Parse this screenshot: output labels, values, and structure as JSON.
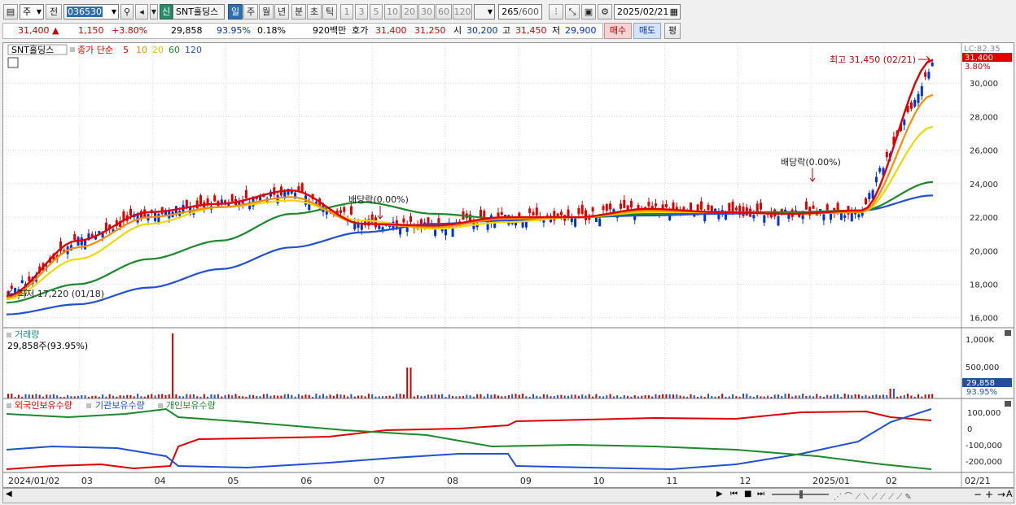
{
  "toolbar": {
    "period_select": "주",
    "prev_label": "전",
    "code": "036530",
    "badge": "신",
    "name": "SNT홀딩스",
    "tabs": [
      "일",
      "주",
      "월",
      "년",
      "분",
      "초",
      "틱"
    ],
    "active_tab": "일",
    "intervals": [
      "1",
      "3",
      "5",
      "10",
      "20",
      "30",
      "60",
      "120"
    ],
    "count": "265",
    "count_max": "/600",
    "date": "2025/02/21"
  },
  "quote": {
    "price": "31,400",
    "change_arrow": "▲",
    "change": "1,150",
    "change_pct": "+3.80%",
    "volume": "29,858",
    "volume_ratio": "93.95%",
    "turnover": "0.18%",
    "amount": "920백만",
    "ask_label": "호가",
    "ask": "31,400",
    "bid": "31,250",
    "open_label": "시",
    "open": "30,200",
    "high_label": "고",
    "high": "31,450",
    "low_label": "저",
    "low": "29,900",
    "buy_label": "매수",
    "sell_label": "매도",
    "eval_label": "평"
  },
  "legend": {
    "name": "SNT홀딩스",
    "close_label": "종가 단순",
    "ma_labels": [
      "5",
      "10",
      "20",
      "60",
      "120"
    ],
    "ma_colors": [
      "#e00000",
      "#ff8c00",
      "#f0d800",
      "#1a8a2a",
      "#2050d8"
    ]
  },
  "price_panel": {
    "lc_label": "LC:82.35",
    "current_price": "31,400",
    "current_pct": "3.80%",
    "y_ticks": [
      "30,000",
      "28,000",
      "26,000",
      "24,000",
      "22,000",
      "20,000",
      "18,000",
      "16,000"
    ],
    "high_annotation": "최고 31,450 (02/21)",
    "low_annotation": "최저 17,220 (01/18)",
    "dividend_label": "배당락(0.00%)"
  },
  "volume_panel": {
    "title": "거래량",
    "current": "29,858주(93.95%)",
    "y_ticks": [
      "1,000K",
      "500,000"
    ],
    "current_badge": "29,858",
    "current_pct": "93.95%"
  },
  "holdings_panel": {
    "legend": [
      "외국인보유수량",
      "기관보유수량",
      "개인보유수량"
    ],
    "legend_colors": [
      "#e00000",
      "#2050d8",
      "#1a8a2a"
    ],
    "y_ticks": [
      "100,000",
      "0",
      "-100,000",
      "-200,000"
    ]
  },
  "x_axis": {
    "labels": [
      "2024/01/02",
      "03",
      "04",
      "05",
      "06",
      "07",
      "08",
      "09",
      "10",
      "11",
      "12",
      "2025/01",
      "02"
    ],
    "right_label": "02/21"
  },
  "chart_data": {
    "type": "line",
    "title": "",
    "xlabel": "",
    "ylabel": "",
    "x": [
      "2024/01",
      "2024/02",
      "2024/03",
      "2024/04",
      "2024/05",
      "2024/06",
      "2024/07",
      "2024/08",
      "2024/09",
      "2024/10",
      "2024/11",
      "2024/12",
      "2025/01",
      "2025/02"
    ],
    "ylim": [
      15500,
      32000
    ],
    "series": [
      {
        "name": "5",
        "values": [
          17300,
          20600,
          22300,
          22800,
          23600,
          21600,
          21500,
          22000,
          22000,
          22500,
          22300,
          22200,
          22400,
          31400
        ]
      },
      {
        "name": "10",
        "values": [
          17200,
          20200,
          22000,
          22600,
          23200,
          21600,
          21400,
          21900,
          22000,
          22400,
          22300,
          22200,
          22300,
          29300
        ]
      },
      {
        "name": "20",
        "values": [
          17100,
          19500,
          21600,
          22600,
          23000,
          21800,
          21300,
          21700,
          22000,
          22300,
          22300,
          22200,
          22300,
          27400
        ]
      },
      {
        "name": "60",
        "values": [
          16900,
          18000,
          19500,
          20600,
          22200,
          22900,
          22200,
          21900,
          22000,
          22200,
          22300,
          22300,
          22400,
          24100
        ]
      },
      {
        "name": "120",
        "values": [
          16200,
          16800,
          17800,
          18900,
          20200,
          21100,
          21600,
          21800,
          22000,
          22100,
          22200,
          22300,
          22400,
          23300
        ]
      }
    ],
    "annotations": [
      "최고 31,450 (02/21)",
      "최저 17,220 (01/18)",
      "배당락(0.00%)"
    ]
  }
}
